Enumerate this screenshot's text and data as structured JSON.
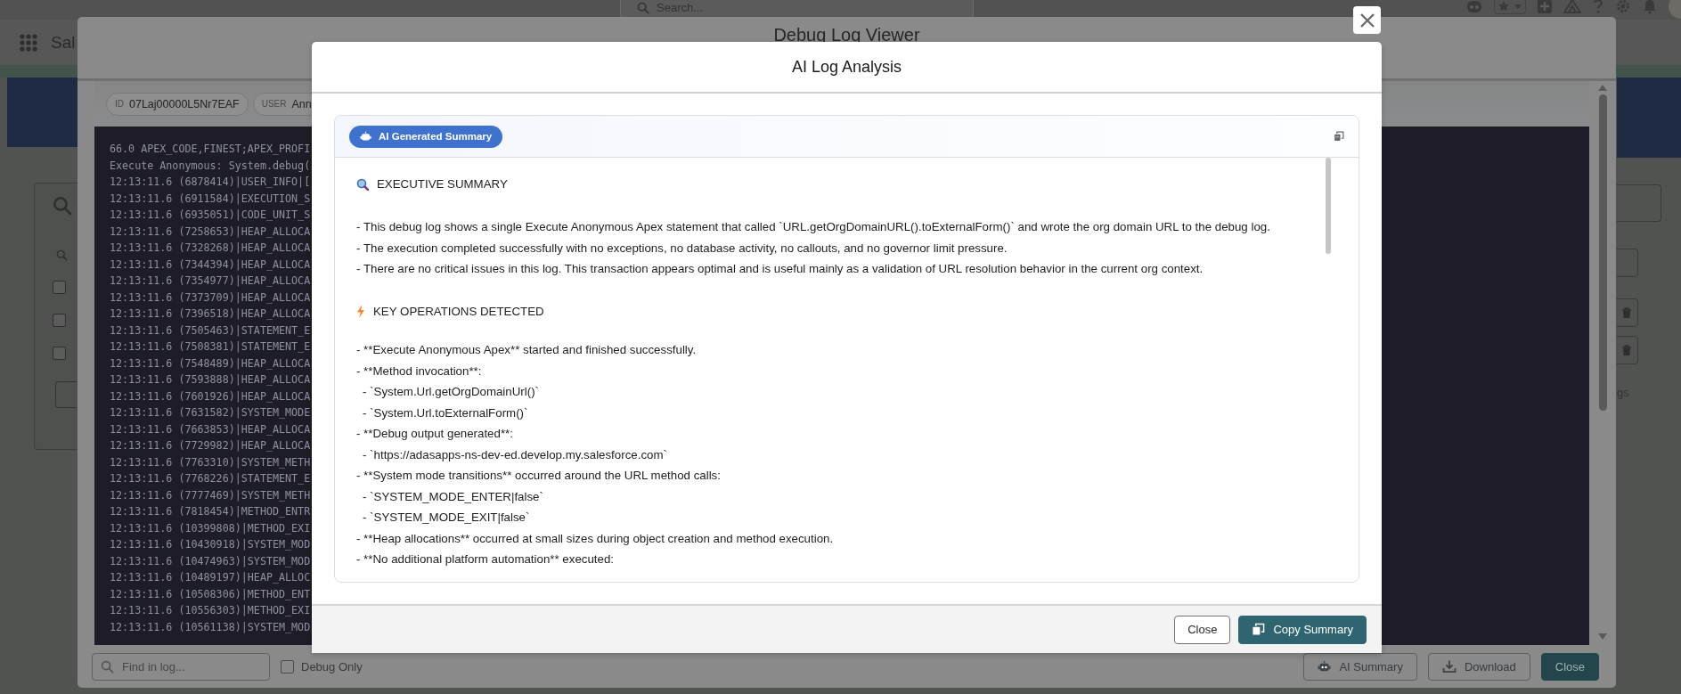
{
  "page": {
    "app_name": "Sal",
    "search_placeholder": "Search...",
    "side_text": "gs",
    "row_checkboxes": [
      {
        "checked": false
      },
      {
        "checked": false
      },
      {
        "checked": false
      }
    ]
  },
  "log_viewer": {
    "title": "Debug Log Viewer",
    "chips": [
      {
        "label": "ID",
        "value": "07Laj00000L5Nr7EAF"
      },
      {
        "label": "USER",
        "value": "Ann"
      }
    ],
    "log_lines": [
      "66.0 APEX_CODE,FINEST;APEX_PROFI",
      "Execute Anonymous: System.debug(",
      "12:13:11.6 (6878414)|USER_INFO|[",
      "12:13:11.6 (6911584)|EXECUTION_S",
      "12:13:11.6 (6935051)|CODE_UNIT_S",
      "12:13:11.6 (7258653)|HEAP_ALLOCA",
      "12:13:11.6 (7328268)|HEAP_ALLOCA",
      "12:13:11.6 (7344394)|HEAP_ALLOCA",
      "12:13:11.6 (7354977)|HEAP_ALLOCA",
      "12:13:11.6 (7373709)|HEAP_ALLOCA",
      "12:13:11.6 (7396518)|HEAP_ALLOCA",
      "12:13:11.6 (7505463)|STATEMENT_E",
      "12:13:11.6 (7508381)|STATEMENT_E",
      "12:13:11.6 (7548489)|HEAP_ALLOCA",
      "12:13:11.6 (7593888)|HEAP_ALLOCA",
      "12:13:11.6 (7601926)|HEAP_ALLOCA",
      "12:13:11.6 (7631582)|SYSTEM_MODE",
      "12:13:11.6 (7663853)|HEAP_ALLOCA",
      "12:13:11.6 (7729982)|HEAP_ALLOCA",
      "12:13:11.6 (7763310)|SYSTEM_METH",
      "12:13:11.6 (7768226)|STATEMENT_E",
      "12:13:11.6 (7777469)|SYSTEM_METH",
      "12:13:11.6 (7818454)|METHOD_ENTR",
      "12:13:11.6 (10399808)|METHOD_EXI",
      "12:13:11.6 (10430918)|SYSTEM_MOD",
      "12:13:11.6 (10474963)|SYSTEM_MOD",
      "12:13:11.6 (10489197)|HEAP_ALLOC",
      "12:13:11.6 (10508306)|METHOD_ENT",
      "12:13:11.6 (10556303)|METHOD_EXI",
      "12:13:11.6 (10561138)|SYSTEM_MOD"
    ],
    "find_placeholder": "Find in log...",
    "debug_only": {
      "label": "Debug Only",
      "checked": false
    },
    "buttons": [
      {
        "label": "AI Summary",
        "kind": "ai"
      },
      {
        "label": "Download",
        "kind": "download"
      },
      {
        "label": "Close",
        "kind": "primary"
      }
    ]
  },
  "analysis": {
    "title": "AI Log Analysis",
    "badge": "AI Generated Summary",
    "sections": [
      {
        "kind": "summary",
        "text": "EXECUTIVE SUMMARY"
      },
      {
        "kind": "bullet",
        "text": "- This debug log shows a single Execute Anonymous Apex statement that called `URL.getOrgDomainURL().toExternalForm()` and wrote the org domain URL to the debug log."
      },
      {
        "kind": "bullet",
        "text": "- The execution completed successfully with no exceptions, no database activity, no callouts, and no governor limit pressure."
      },
      {
        "kind": "bullet",
        "text": "- There are no critical issues in this log. This transaction appears optimal and is useful mainly as a validation of URL resolution behavior in the current org context."
      },
      {
        "kind": "operations",
        "text": "KEY OPERATIONS DETECTED"
      },
      {
        "kind": "bullet",
        "text": "- **Execute Anonymous Apex** started and finished successfully."
      },
      {
        "kind": "bullet",
        "text": "- **Method invocation**:"
      },
      {
        "kind": "subbullet",
        "text": "- `System.Url.getOrgDomainUrl()`"
      },
      {
        "kind": "subbullet",
        "text": "- `System.Url.toExternalForm()`"
      },
      {
        "kind": "bullet",
        "text": "- **Debug output generated**:"
      },
      {
        "kind": "subbullet",
        "text": "- `https://adasapps-ns-dev-ed.develop.my.salesforce.com`"
      },
      {
        "kind": "bullet",
        "text": "- **System mode transitions** occurred around the URL method calls:"
      },
      {
        "kind": "subbullet",
        "text": "- `SYSTEM_MODE_ENTER|false`"
      },
      {
        "kind": "subbullet",
        "text": "- `SYSTEM_MODE_EXIT|false`"
      },
      {
        "kind": "bullet",
        "text": "- **Heap allocations** occurred at small sizes during object creation and method execution."
      },
      {
        "kind": "bullet",
        "text": "- **No additional platform automation** executed:"
      }
    ],
    "buttons": [
      {
        "label": "Close",
        "kind": "secondary"
      },
      {
        "label": "Copy Summary",
        "kind": "primary"
      }
    ]
  }
}
